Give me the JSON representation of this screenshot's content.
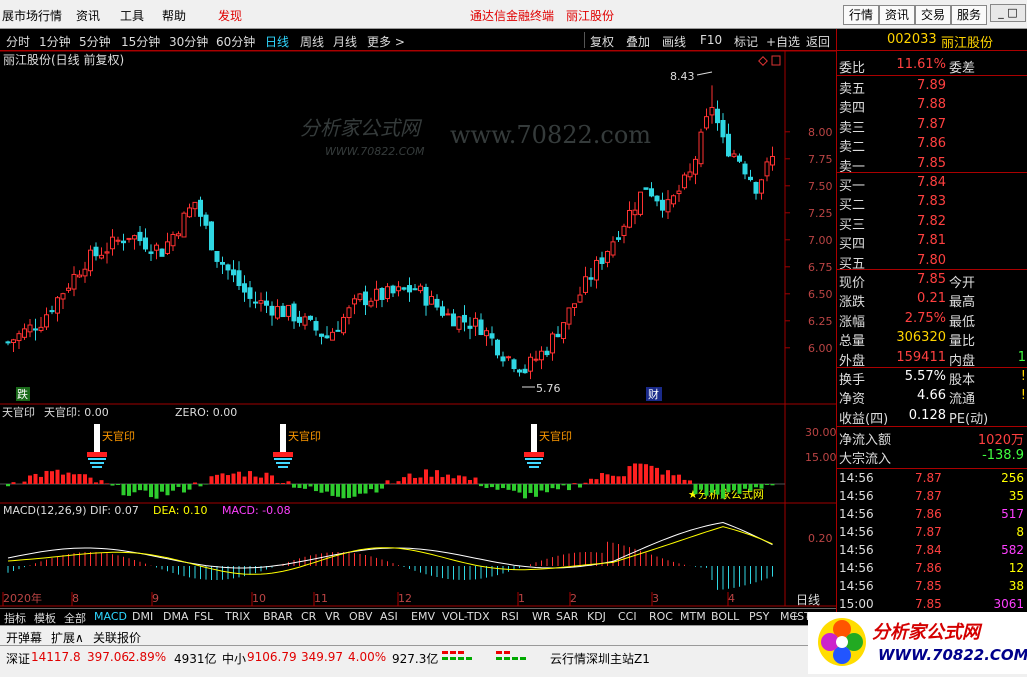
{
  "menubar": {
    "items": [
      "展市场行情",
      "资讯",
      "工具",
      "帮助"
    ],
    "active": "发现",
    "center1": "通达信金融终端",
    "center2": "丽江股份",
    "right_btns": [
      "行情",
      "资讯",
      "交易",
      "服务"
    ],
    "win_btns": [
      "_",
      "□",
      "×"
    ]
  },
  "periods": [
    "分时",
    "1分钟",
    "5分钟",
    "15分钟",
    "30分钟",
    "60分钟",
    "日线",
    "周线",
    "月线",
    "更多 >"
  ],
  "active_period": "日线",
  "right_tools": [
    "复权",
    "叠加",
    "画线",
    "F10",
    "标记",
    "+自选",
    "返回"
  ],
  "chart": {
    "title": "丽江股份(日线 前复权)",
    "high_label": "8.43",
    "low_label": "5.76",
    "die_mark": "跌",
    "cai_mark": "财",
    "watermark1": "分析家公式网",
    "watermark2": "www.70822.com",
    "watermark3": "WWW.70822.COM",
    "price_ticks": [
      "8.00",
      "7.75",
      "7.50",
      "7.25",
      "7.00",
      "6.75",
      "6.50",
      "6.25",
      "6.00"
    ],
    "ind1_title": "天官印",
    "ind1_line": "天官印: 0.00",
    "ind1_zero": "ZERO: 0.00",
    "ind1_ticks": [
      "30.00",
      "15.00"
    ],
    "ind1_signal": "天官印",
    "ind1_credit": "★分析家公式网",
    "macd_title": "MACD(12,26,9)",
    "dif": "DIF: 0.07",
    "dea": "DEA: 0.10",
    "macd": "MACD: -0.08",
    "macd_tick": "0.20",
    "x_labels": [
      "2020年",
      "8",
      "9",
      "10",
      "11",
      "12",
      "1",
      "2",
      "3",
      "4"
    ],
    "x_period": "日线",
    "colors": {
      "up": "#ff3232",
      "down": "#2fd7e3",
      "dif": "#ffffff",
      "dea": "#ffff00",
      "macd_label": "#ff40ff",
      "grid": "#a00000"
    }
  },
  "chart_data": {
    "type": "candlestick",
    "ylim": [
      5.6,
      8.6
    ],
    "high": 8.43,
    "low": 5.76
  },
  "quote": {
    "code": "002033",
    "name": "丽江股份",
    "weibi_l": "委比",
    "weibi_v": "11.61%",
    "weicha_l": "委差",
    "sells": [
      {
        "l": "卖五",
        "v": "7.89"
      },
      {
        "l": "卖四",
        "v": "7.88"
      },
      {
        "l": "卖三",
        "v": "7.87"
      },
      {
        "l": "卖二",
        "v": "7.86"
      },
      {
        "l": "卖一",
        "v": "7.85"
      }
    ],
    "buys": [
      {
        "l": "买一",
        "v": "7.84"
      },
      {
        "l": "买二",
        "v": "7.83"
      },
      {
        "l": "买三",
        "v": "7.82"
      },
      {
        "l": "买四",
        "v": "7.81"
      },
      {
        "l": "买五",
        "v": "7.80"
      }
    ],
    "stats": [
      {
        "l": "现价",
        "v": "7.85",
        "c": "#ff4040",
        "l2": "今开"
      },
      {
        "l": "涨跌",
        "v": "0.21",
        "c": "#ff4040",
        "l2": "最高"
      },
      {
        "l": "涨幅",
        "v": "2.75%",
        "c": "#ff4040",
        "l2": "最低"
      },
      {
        "l": "总量",
        "v": "306320",
        "c": "#ffd400",
        "l2": "量比"
      },
      {
        "l": "外盘",
        "v": "159411",
        "c": "#ff4040",
        "l2": "内盘",
        "v2": "1",
        "c2": "#40ff40"
      }
    ],
    "stats2": [
      {
        "l": "换手",
        "v": "5.57%",
        "c": "#ffffff",
        "l2": "股本",
        "v2": "!"
      },
      {
        "l": "净资",
        "v": "4.66",
        "c": "#ffffff",
        "l2": "流通",
        "v2": "!"
      },
      {
        "l": "收益(四)",
        "v": "0.128",
        "c": "#ffffff",
        "l2": "PE(动)",
        "v2": ""
      }
    ],
    "flow": [
      {
        "l": "净流入额",
        "v": "1020万",
        "c": "#ff4040"
      },
      {
        "l": "大宗流入",
        "v": "-138.9",
        "c": "#40ff40"
      }
    ],
    "ticks": [
      {
        "t": "14:56",
        "p": "7.87",
        "q": "256",
        "c": "#ffff00"
      },
      {
        "t": "14:56",
        "p": "7.87",
        "q": "35",
        "c": "#ffff00"
      },
      {
        "t": "14:56",
        "p": "7.86",
        "q": "517",
        "c": "#ff40ff"
      },
      {
        "t": "14:56",
        "p": "7.87",
        "q": "8",
        "c": "#ffff00"
      },
      {
        "t": "14:56",
        "p": "7.84",
        "q": "582",
        "c": "#ff40ff"
      },
      {
        "t": "14:56",
        "p": "7.86",
        "q": "12",
        "c": "#ffff00"
      },
      {
        "t": "14:56",
        "p": "7.85",
        "q": "38",
        "c": "#ffff00"
      },
      {
        "t": "15:00",
        "p": "7.85",
        "q": "3061",
        "c": "#ff40ff"
      }
    ]
  },
  "tabs": [
    "指标",
    "模板",
    "全部",
    "MACD",
    "DMI",
    "DMA",
    "FSL",
    "TRIX",
    "BRAR",
    "CR",
    "VR",
    "OBV",
    "ASI",
    "EMV",
    "VOL-TDX",
    "RSI",
    "WR",
    "SAR",
    "KDJ",
    "CCI",
    "ROC",
    "MTM",
    "BOLL",
    "PSY",
    "MCST"
  ],
  "active_tab": "MACD",
  "bar2": [
    "开弹幕",
    "扩展∧",
    "关联报价"
  ],
  "status": {
    "sz_label": "深证",
    "sz_val": "14117.8",
    "sz_chg": "397.06",
    "sz_pct": "2.89%",
    "sz_amt": "4931亿",
    "zx_label": "中小",
    "zx_val": "9106.79",
    "zx_chg": "349.97",
    "zx_pct": "4.00%",
    "zx_amt": "927.3亿",
    "server": "云行情深圳主站Z1"
  },
  "logo": {
    "line1": "分析家公式网",
    "line2": "WWW.70822.COM"
  }
}
